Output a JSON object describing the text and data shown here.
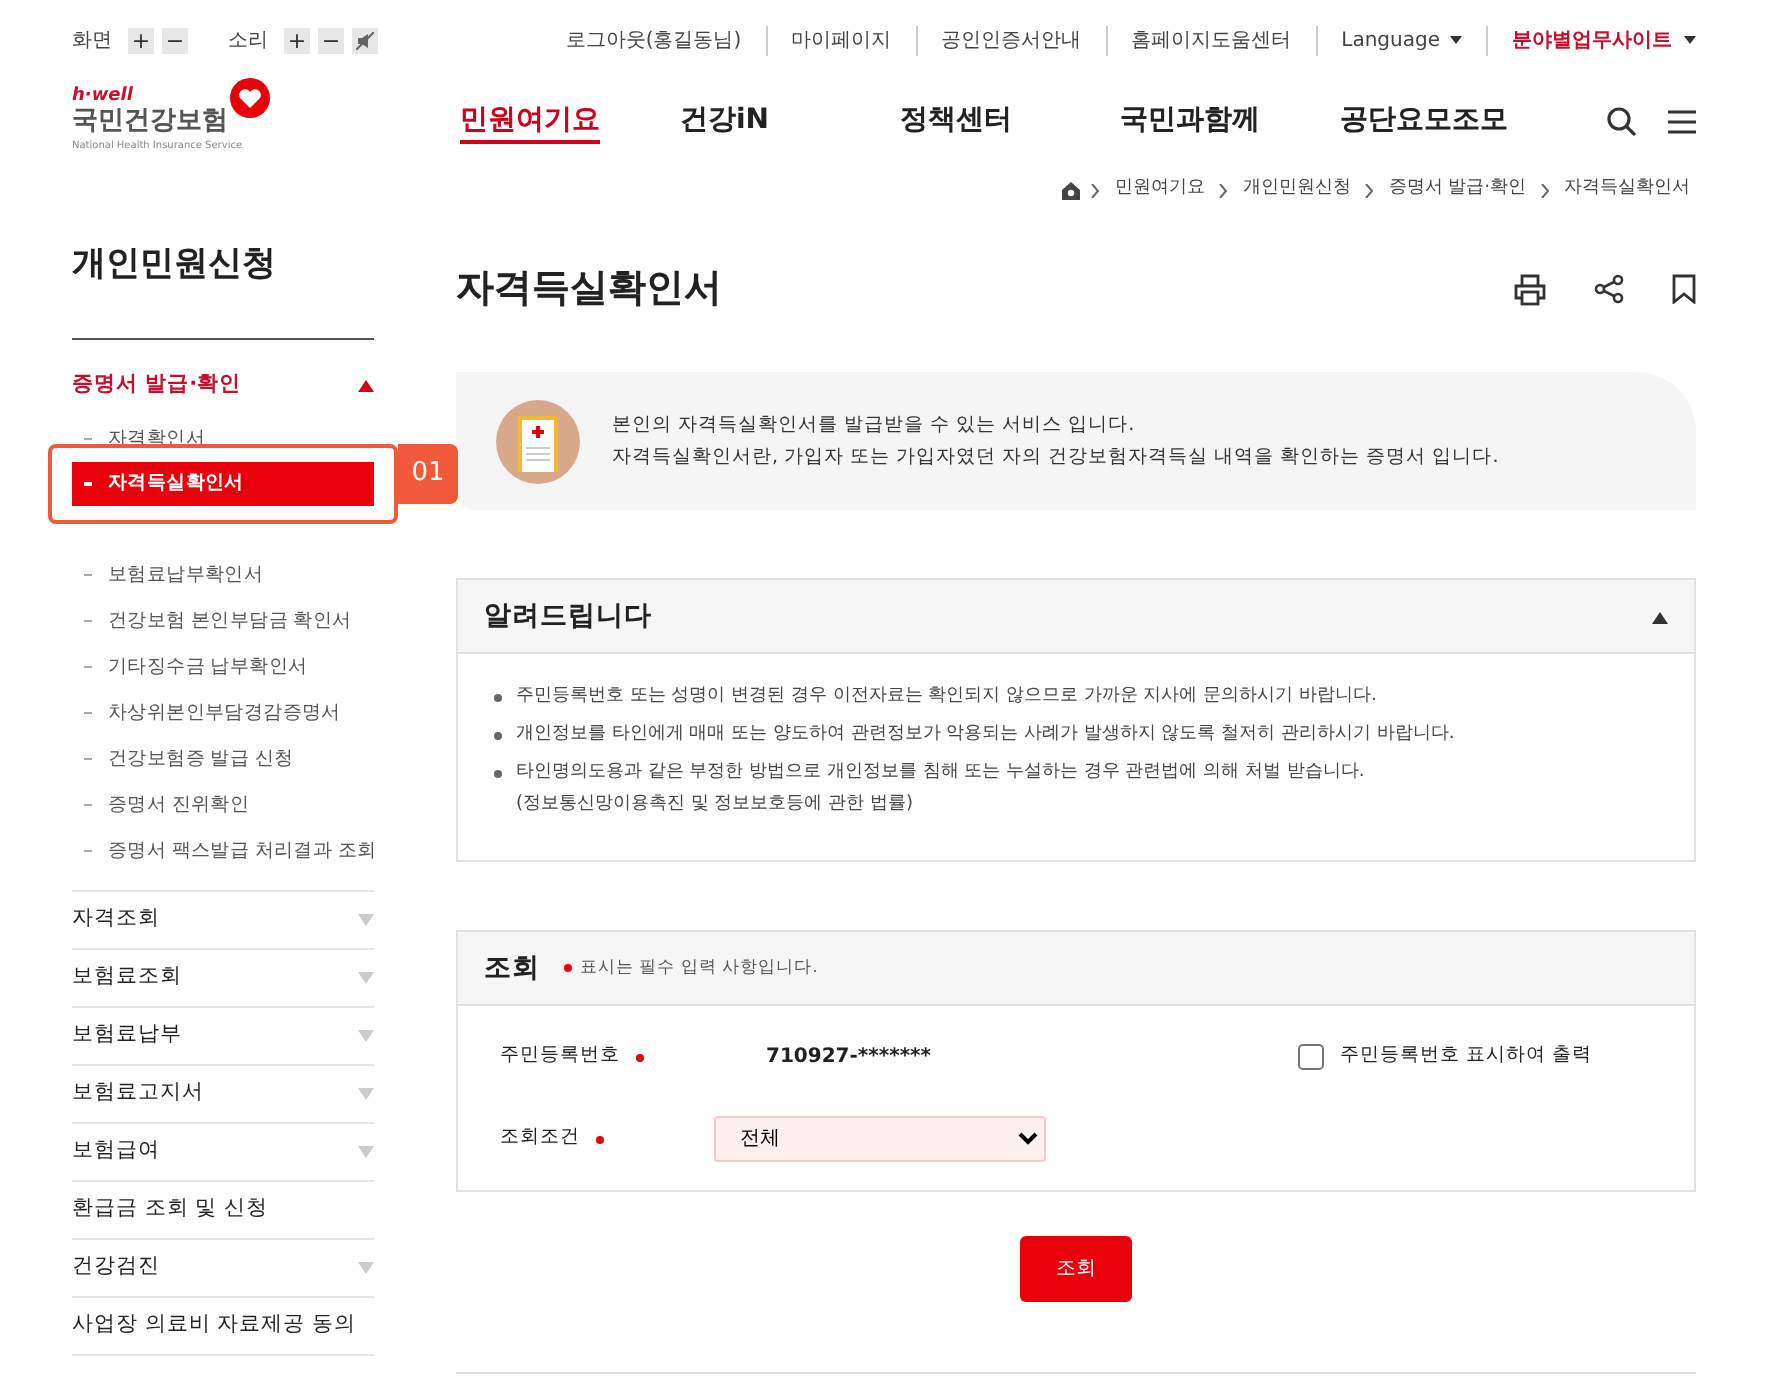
{
  "utility": {
    "zoom_label": "화면",
    "sound_label": "소리",
    "plus": "+",
    "minus": "−",
    "links": [
      "로그아웃(홍길동님)",
      "마이페이지",
      "공인인증서안내",
      "홈페이지도움센터"
    ],
    "language": "Language",
    "sites": "분야별업무사이트"
  },
  "logo": {
    "tagline": "h·well",
    "name": "국민건강보험",
    "english": "National Health Insurance Service"
  },
  "nav": [
    {
      "label": "민원여기요",
      "selected": true
    },
    {
      "label": "건강iN",
      "selected": false
    },
    {
      "label": "정책센터",
      "selected": false
    },
    {
      "label": "국민과함께",
      "selected": false
    },
    {
      "label": "공단요모조모",
      "selected": false
    }
  ],
  "breadcrumb": [
    "민원여기요",
    "개인민원신청",
    "증명서 발급·확인",
    "자격득실확인서"
  ],
  "sidebar": {
    "title": "개인민원신청",
    "groups": [
      {
        "label": "증명서 발급·확인",
        "kind": "group",
        "expanded": true,
        "children": [
          {
            "label": "자격확인서",
            "selected": false
          },
          {
            "label": "자격득실확인서",
            "selected": true
          },
          {
            "label": "보험료납부확인서",
            "selected": false
          },
          {
            "label": "건강보험 본인부담금 확인서",
            "selected": false
          },
          {
            "label": "기타징수금 납부확인서",
            "selected": false
          },
          {
            "label": "차상위본인부담경감증명서",
            "selected": false
          },
          {
            "label": "건강보험증 발급 신청",
            "selected": false
          },
          {
            "label": "증명서 진위확인",
            "selected": false
          },
          {
            "label": "증명서 팩스발급 처리결과 조회",
            "selected": false
          }
        ]
      },
      {
        "label": "자격조회",
        "kind": "group",
        "expanded": false
      },
      {
        "label": "보험료조회",
        "kind": "group",
        "expanded": false
      },
      {
        "label": "보험료납부",
        "kind": "group",
        "expanded": false
      },
      {
        "label": "보험료고지서",
        "kind": "group",
        "expanded": false
      },
      {
        "label": "보험급여",
        "kind": "group",
        "expanded": false
      },
      {
        "label": "환급금 조회 및 신청",
        "kind": "link"
      },
      {
        "label": "건강검진",
        "kind": "group",
        "expanded": false
      },
      {
        "label": "사업장 의료비 자료제공 동의",
        "kind": "link"
      }
    ]
  },
  "callout": {
    "number": "01"
  },
  "page_title": "자격득실확인서",
  "intro": [
    "본인의 자격득실확인서를 발급받을 수 있는 서비스 입니다.",
    "자격득실확인서란, 가입자 또는 가입자였던 자의 건강보험자격득실 내역을 확인하는 증명서 입니다."
  ],
  "notice": {
    "title": "알려드립니다",
    "expanded": true,
    "items": [
      "주민등록번호 또는 성명이 변경된 경우 이전자료는 확인되지 않으므로 가까운 지사에 문의하시기 바랍니다.",
      "개인정보를 타인에게 매매 또는 양도하여 관련정보가 악용되는 사례가 발생하지 않도록 철저히 관리하시기 바랍니다.",
      "타인명의도용과 같은 부정한 방법으로 개인정보를 침해 또는 누설하는 경우 관련법에 의해 처벌 받습니다.\n(정보통신망이용촉진 및 정보보호등에 관한 법률)"
    ]
  },
  "form": {
    "title": "조회",
    "required_note": "표시는 필수 입력 사항입니다.",
    "id_label": "주민등록번호",
    "id_value": "710927-*******",
    "show_id": {
      "label": "주민등록번호 표시하여 출력",
      "checked": false
    },
    "condition_label": "조회조건",
    "condition_value": "전체",
    "submit": "조회"
  }
}
